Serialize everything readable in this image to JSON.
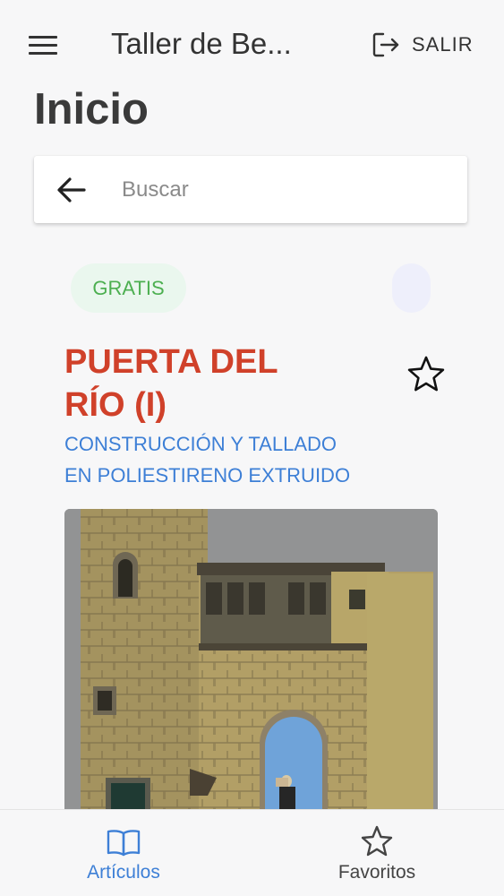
{
  "header": {
    "menu_icon": "hamburger-menu-icon",
    "app_title": "Taller de Be...",
    "logout_icon": "logout-icon",
    "logout_label": "SALIR"
  },
  "page": {
    "title": "Inicio"
  },
  "search": {
    "back_icon": "arrow-left-icon",
    "placeholder": "Buscar",
    "value": ""
  },
  "article": {
    "badge": "GRATIS",
    "badge_color": "#4caf50",
    "title_line1": "PUERTA DEL",
    "title_line2": "RÍO (I)",
    "title_color": "#d0412a",
    "subtitle_line1": "CONSTRUCCIÓN Y TALLADO",
    "subtitle_line2": "EN POLIESTIRENO EXTRUIDO",
    "subtitle_color": "#3d7fd6",
    "favorite_icon": "star-outline-icon",
    "image_alt": "Maqueta de puerta de piedra con torre"
  },
  "bottom_nav": {
    "items": [
      {
        "label": "Artículos",
        "icon": "open-book-icon",
        "active": true
      },
      {
        "label": "Favoritos",
        "icon": "star-outline-icon",
        "active": false
      }
    ],
    "active_color": "#3d7fd6"
  }
}
